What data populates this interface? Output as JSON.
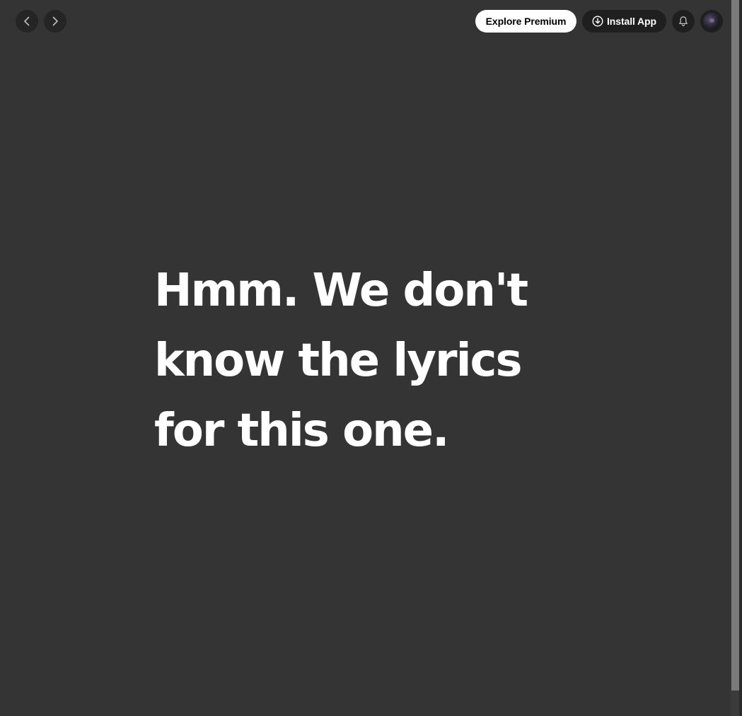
{
  "topbar": {
    "back_icon": "chevron-left-icon",
    "forward_icon": "chevron-right-icon",
    "premium_label": "Explore Premium",
    "install_label": "Install App",
    "install_icon": "download-circle-icon",
    "bell_icon": "bell-icon",
    "avatar_icon": "user-avatar"
  },
  "main": {
    "lyrics_message": "Hmm. We don't know the lyrics for this one."
  },
  "colors": {
    "background": "#343434",
    "premium_button_bg": "#ffffff",
    "dark_button_bg": "#1f1f1f",
    "text": "#ffffff"
  }
}
